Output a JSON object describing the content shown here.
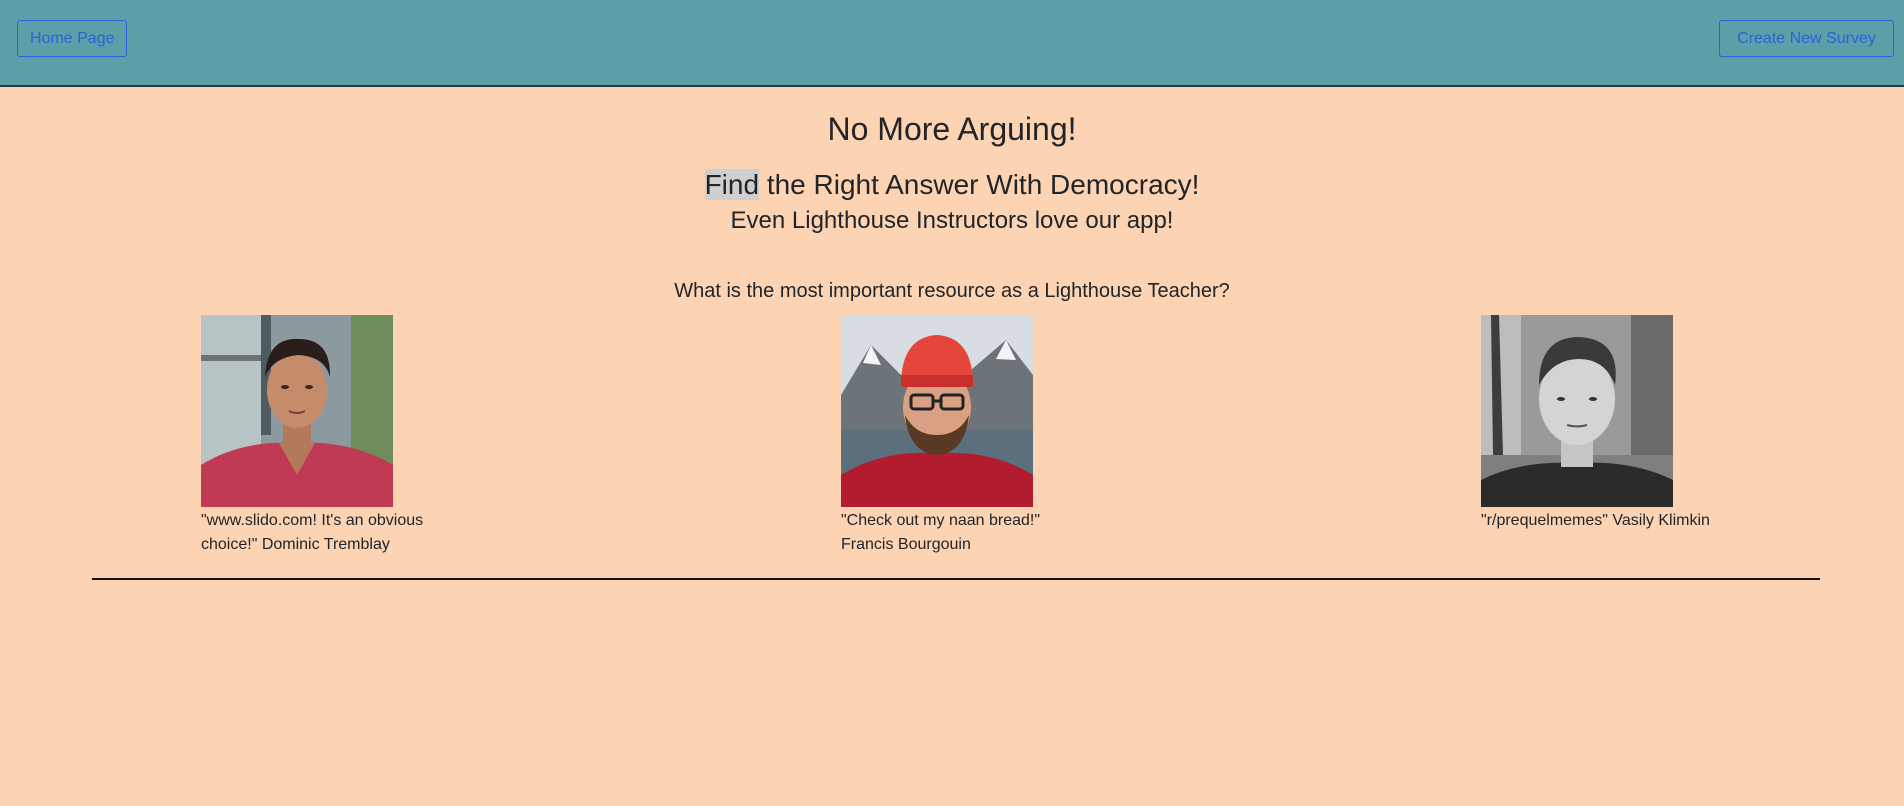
{
  "nav": {
    "home_label": "Home Page",
    "create_label": "Create New Survey"
  },
  "hero": {
    "headline": "No More Arguing!",
    "subheadline_highlight": "Find",
    "subheadline_rest": " the Right Answer With Democracy!",
    "tagline": "Even Lighthouse Instructors love our app!",
    "question": "What is the most important resource as a Lighthouse Teacher?"
  },
  "testimonials": [
    {
      "quote": "\"www.slido.com! It's an obvious choice!\" Dominic Tremblay",
      "photo_icon": "person-photo-red-shirt"
    },
    {
      "quote": "\"Check out my naan bread!\" Francis Bourgouin",
      "photo_icon": "person-photo-red-beanie"
    },
    {
      "quote": "\"r/prequelmemes\" Vasily Klimkin",
      "photo_icon": "person-photo-grayscale"
    }
  ],
  "colors": {
    "navbar": "#5c9fa8",
    "page_background": "#fcd3b3",
    "button_accent": "#2b63d8"
  }
}
